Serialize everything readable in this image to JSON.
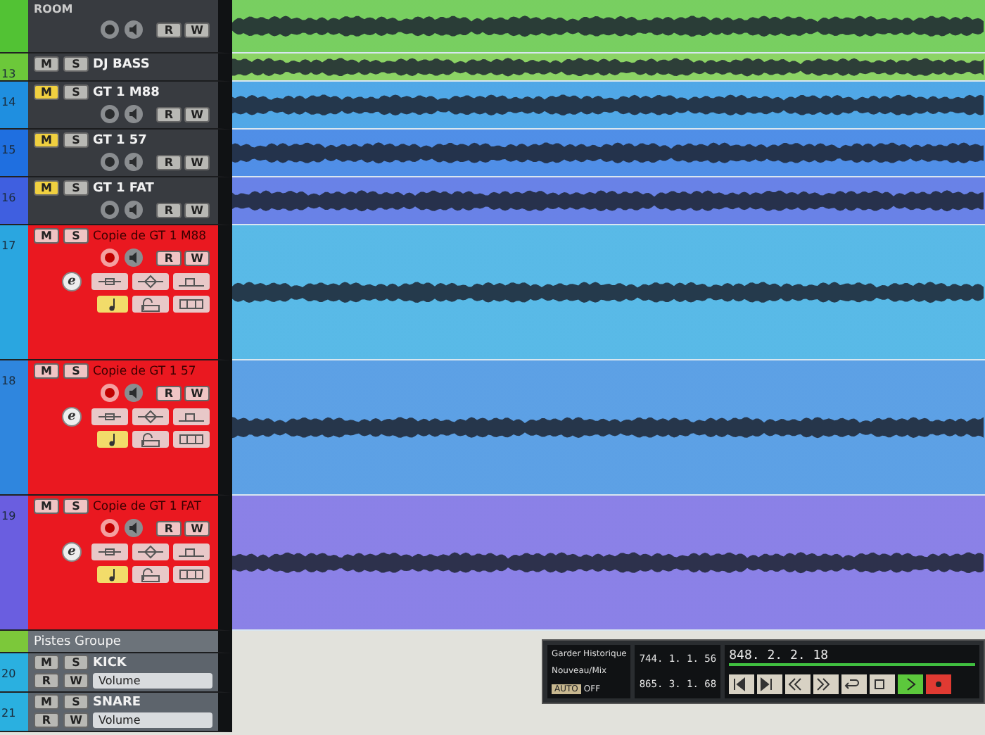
{
  "tracks": [
    {
      "kind": "audio_partial",
      "name": "ROOM",
      "color": "#52c234",
      "selected": false,
      "armed": false,
      "read_label": "R",
      "write_label": "W"
    },
    {
      "kind": "audio_collapsed",
      "number": "13",
      "name": "DJ BASS",
      "color": "#6cc83a",
      "selected": false,
      "muted": false,
      "mute_label": "M",
      "solo_label": "S"
    },
    {
      "kind": "audio",
      "number": "14",
      "name": "GT 1 M88",
      "color": "#1f8fe0",
      "selected": false,
      "muted": true,
      "armed": false,
      "mute_label": "M",
      "solo_label": "S",
      "read_label": "R",
      "write_label": "W"
    },
    {
      "kind": "audio",
      "number": "15",
      "name": "GT 1 57",
      "color": "#1f6fe0",
      "selected": false,
      "muted": true,
      "armed": false,
      "mute_label": "M",
      "solo_label": "S",
      "read_label": "R",
      "write_label": "W"
    },
    {
      "kind": "audio",
      "number": "16",
      "name": "GT 1 FAT",
      "color": "#3f5fe0",
      "selected": false,
      "muted": true,
      "armed": false,
      "mute_label": "M",
      "solo_label": "S",
      "read_label": "R",
      "write_label": "W"
    },
    {
      "kind": "audio_tall",
      "number": "17",
      "name": "Copie de GT 1 M88",
      "color": "#2aa6e0",
      "selected": true,
      "muted": false,
      "armed": true,
      "musical_time": true,
      "mute_label": "M",
      "solo_label": "S",
      "read_label": "R",
      "write_label": "W",
      "edit_label": "e"
    },
    {
      "kind": "audio_tall",
      "number": "18",
      "name": "Copie de GT 1 57",
      "color": "#2f86de",
      "selected": true,
      "muted": false,
      "armed": true,
      "musical_time": true,
      "mute_label": "M",
      "solo_label": "S",
      "read_label": "R",
      "write_label": "W",
      "edit_label": "e"
    },
    {
      "kind": "audio_tall",
      "number": "19",
      "name": "Copie de GT 1 FAT",
      "color": "#6a5ee0",
      "selected": true,
      "muted": false,
      "armed": true,
      "musical_time": true,
      "mute_label": "M",
      "solo_label": "S",
      "read_label": "R",
      "write_label": "W",
      "edit_label": "e"
    },
    {
      "kind": "folder",
      "name": "Pistes Groupe",
      "color": "#7cc83a",
      "selected": false
    },
    {
      "kind": "compact",
      "number": "20",
      "name": "KICK",
      "color": "#2ab0e0",
      "selected": false,
      "muted": false,
      "mute_label": "M",
      "solo_label": "S",
      "read_label": "R",
      "write_label": "W",
      "automation": "Volume"
    },
    {
      "kind": "compact",
      "number": "21",
      "name": "SNARE",
      "color": "#2ab0e0",
      "selected": false,
      "muted": false,
      "mute_label": "M",
      "solo_label": "S",
      "read_label": "R",
      "write_label": "W",
      "automation": "Volume"
    }
  ],
  "transport": {
    "history": "Garder Historique",
    "mode": "Nouveau/Mix",
    "auto_label": "AUTO",
    "auto_value": "OFF",
    "left_locator": "744. 1. 1. 56",
    "right_locator": "865. 3. 1. 68",
    "position": "848. 2. 2. 18"
  }
}
